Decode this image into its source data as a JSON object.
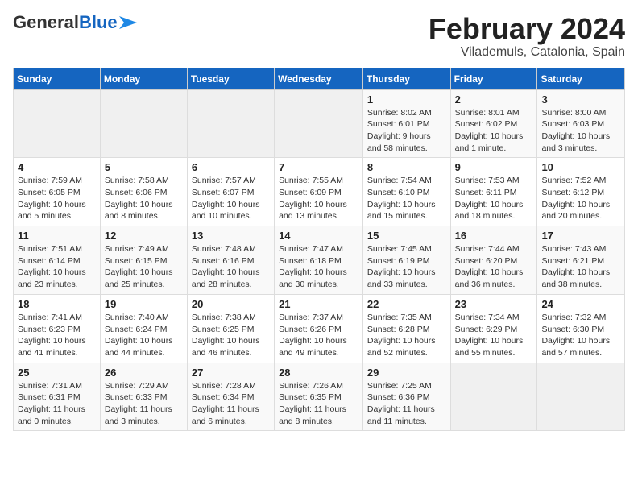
{
  "header": {
    "logo_general": "General",
    "logo_blue": "Blue",
    "title": "February 2024",
    "subtitle": "Vilademuls, Catalonia, Spain"
  },
  "days_of_week": [
    "Sunday",
    "Monday",
    "Tuesday",
    "Wednesday",
    "Thursday",
    "Friday",
    "Saturday"
  ],
  "weeks": [
    [
      {
        "day": "",
        "info": ""
      },
      {
        "day": "",
        "info": ""
      },
      {
        "day": "",
        "info": ""
      },
      {
        "day": "",
        "info": ""
      },
      {
        "day": "1",
        "info": "Sunrise: 8:02 AM\nSunset: 6:01 PM\nDaylight: 9 hours\nand 58 minutes."
      },
      {
        "day": "2",
        "info": "Sunrise: 8:01 AM\nSunset: 6:02 PM\nDaylight: 10 hours\nand 1 minute."
      },
      {
        "day": "3",
        "info": "Sunrise: 8:00 AM\nSunset: 6:03 PM\nDaylight: 10 hours\nand 3 minutes."
      }
    ],
    [
      {
        "day": "4",
        "info": "Sunrise: 7:59 AM\nSunset: 6:05 PM\nDaylight: 10 hours\nand 5 minutes."
      },
      {
        "day": "5",
        "info": "Sunrise: 7:58 AM\nSunset: 6:06 PM\nDaylight: 10 hours\nand 8 minutes."
      },
      {
        "day": "6",
        "info": "Sunrise: 7:57 AM\nSunset: 6:07 PM\nDaylight: 10 hours\nand 10 minutes."
      },
      {
        "day": "7",
        "info": "Sunrise: 7:55 AM\nSunset: 6:09 PM\nDaylight: 10 hours\nand 13 minutes."
      },
      {
        "day": "8",
        "info": "Sunrise: 7:54 AM\nSunset: 6:10 PM\nDaylight: 10 hours\nand 15 minutes."
      },
      {
        "day": "9",
        "info": "Sunrise: 7:53 AM\nSunset: 6:11 PM\nDaylight: 10 hours\nand 18 minutes."
      },
      {
        "day": "10",
        "info": "Sunrise: 7:52 AM\nSunset: 6:12 PM\nDaylight: 10 hours\nand 20 minutes."
      }
    ],
    [
      {
        "day": "11",
        "info": "Sunrise: 7:51 AM\nSunset: 6:14 PM\nDaylight: 10 hours\nand 23 minutes."
      },
      {
        "day": "12",
        "info": "Sunrise: 7:49 AM\nSunset: 6:15 PM\nDaylight: 10 hours\nand 25 minutes."
      },
      {
        "day": "13",
        "info": "Sunrise: 7:48 AM\nSunset: 6:16 PM\nDaylight: 10 hours\nand 28 minutes."
      },
      {
        "day": "14",
        "info": "Sunrise: 7:47 AM\nSunset: 6:18 PM\nDaylight: 10 hours\nand 30 minutes."
      },
      {
        "day": "15",
        "info": "Sunrise: 7:45 AM\nSunset: 6:19 PM\nDaylight: 10 hours\nand 33 minutes."
      },
      {
        "day": "16",
        "info": "Sunrise: 7:44 AM\nSunset: 6:20 PM\nDaylight: 10 hours\nand 36 minutes."
      },
      {
        "day": "17",
        "info": "Sunrise: 7:43 AM\nSunset: 6:21 PM\nDaylight: 10 hours\nand 38 minutes."
      }
    ],
    [
      {
        "day": "18",
        "info": "Sunrise: 7:41 AM\nSunset: 6:23 PM\nDaylight: 10 hours\nand 41 minutes."
      },
      {
        "day": "19",
        "info": "Sunrise: 7:40 AM\nSunset: 6:24 PM\nDaylight: 10 hours\nand 44 minutes."
      },
      {
        "day": "20",
        "info": "Sunrise: 7:38 AM\nSunset: 6:25 PM\nDaylight: 10 hours\nand 46 minutes."
      },
      {
        "day": "21",
        "info": "Sunrise: 7:37 AM\nSunset: 6:26 PM\nDaylight: 10 hours\nand 49 minutes."
      },
      {
        "day": "22",
        "info": "Sunrise: 7:35 AM\nSunset: 6:28 PM\nDaylight: 10 hours\nand 52 minutes."
      },
      {
        "day": "23",
        "info": "Sunrise: 7:34 AM\nSunset: 6:29 PM\nDaylight: 10 hours\nand 55 minutes."
      },
      {
        "day": "24",
        "info": "Sunrise: 7:32 AM\nSunset: 6:30 PM\nDaylight: 10 hours\nand 57 minutes."
      }
    ],
    [
      {
        "day": "25",
        "info": "Sunrise: 7:31 AM\nSunset: 6:31 PM\nDaylight: 11 hours\nand 0 minutes."
      },
      {
        "day": "26",
        "info": "Sunrise: 7:29 AM\nSunset: 6:33 PM\nDaylight: 11 hours\nand 3 minutes."
      },
      {
        "day": "27",
        "info": "Sunrise: 7:28 AM\nSunset: 6:34 PM\nDaylight: 11 hours\nand 6 minutes."
      },
      {
        "day": "28",
        "info": "Sunrise: 7:26 AM\nSunset: 6:35 PM\nDaylight: 11 hours\nand 8 minutes."
      },
      {
        "day": "29",
        "info": "Sunrise: 7:25 AM\nSunset: 6:36 PM\nDaylight: 11 hours\nand 11 minutes."
      },
      {
        "day": "",
        "info": ""
      },
      {
        "day": "",
        "info": ""
      }
    ]
  ]
}
